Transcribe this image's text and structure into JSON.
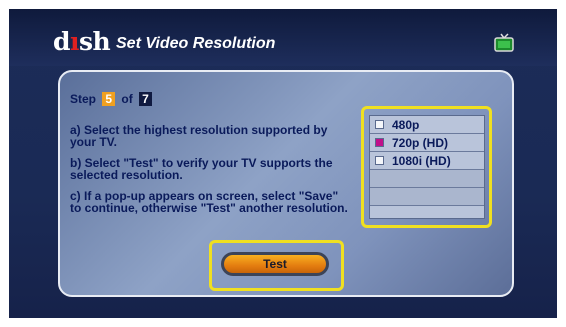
{
  "header": {
    "logo_prefix": "d",
    "logo_suffix": "sh",
    "title": "Set Video Resolution"
  },
  "step": {
    "label": "Step",
    "current": "5",
    "of_label": "of",
    "total": "7"
  },
  "instructions": [
    "a) Select the highest resolution supported by your TV.",
    "b) Select \"Test\" to verify your TV supports the selected resolution.",
    "c) If a pop-up appears on screen, select \"Save\" to continue, otherwise \"Test\" another resolution."
  ],
  "resolutions": [
    {
      "label": "480p",
      "selected": false
    },
    {
      "label": "720p (HD)",
      "selected": true
    },
    {
      "label": "1080i (HD)",
      "selected": false
    }
  ],
  "test_button": {
    "label": "Test"
  },
  "colors": {
    "focus_outline": "#f0e020",
    "selected_marker": "#c0108a",
    "step_current": "#f0a020"
  }
}
